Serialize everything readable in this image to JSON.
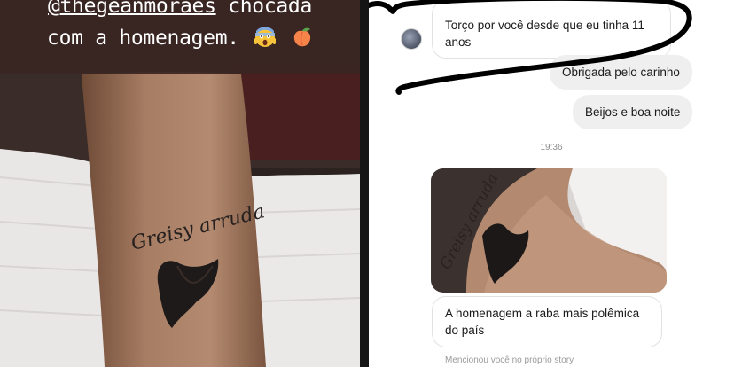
{
  "story": {
    "caption_line1": "@thegeanmoraes chocada",
    "caption_mention": "@thegeanmoraes",
    "caption_rest": "chocada",
    "caption_line2": "com a homenagem.",
    "emojis": [
      "face-screaming-in-fear-icon",
      "peach-icon"
    ],
    "tattoo_text": "Greisy arruda"
  },
  "chat": {
    "messages": [
      {
        "direction": "incoming",
        "text": "Torço por você desde que eu tinha 11 anos"
      },
      {
        "direction": "outgoing",
        "text": "Obrigada pelo carinho"
      },
      {
        "direction": "outgoing",
        "text": "Beijos e boa noite"
      }
    ],
    "timestamp": "19:36",
    "shared_photo_tattoo_text": "Greisy arruda",
    "reply": {
      "direction": "incoming",
      "text": "A homenagem a raba mais polêmica do país"
    },
    "mention_note": "Mencionou você no próprio story"
  },
  "colors": {
    "caption_bg": "#3a2622",
    "bubble_outgoing": "#efefef",
    "bubble_incoming_border": "#e2e2e2",
    "scribble": "#000000"
  }
}
